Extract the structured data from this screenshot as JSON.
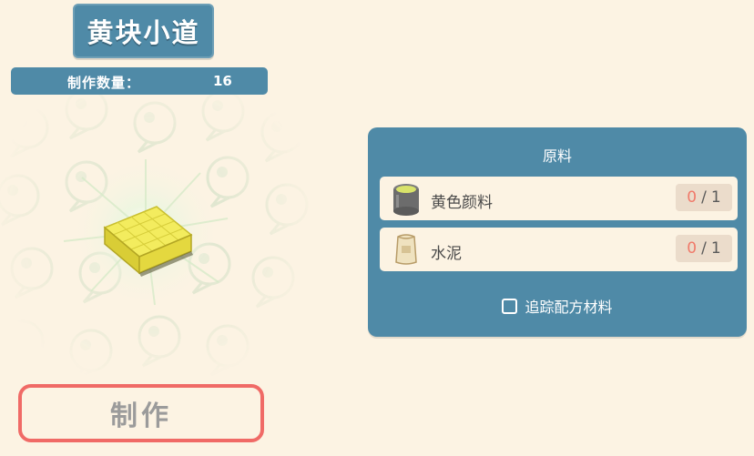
{
  "item": {
    "title": "黄块小道",
    "icon": "yellow-block-path-icon"
  },
  "quantity": {
    "label": "制作数量：",
    "value": "16"
  },
  "craft_button": {
    "label": "制作"
  },
  "materials": {
    "header": "原料",
    "items": [
      {
        "name": "黄色颜料",
        "have": "0",
        "need": "1",
        "icon": "paint-bucket-icon"
      },
      {
        "name": "水泥",
        "have": "0",
        "need": "1",
        "icon": "cement-bag-icon"
      }
    ],
    "separator": "/",
    "track_label": "追踪配方材料",
    "track_checked": false
  },
  "colors": {
    "panel": "#4f8aa7",
    "background": "#fcf3e3",
    "craft_border": "#f06a66",
    "count_have": "#f07a6a"
  }
}
